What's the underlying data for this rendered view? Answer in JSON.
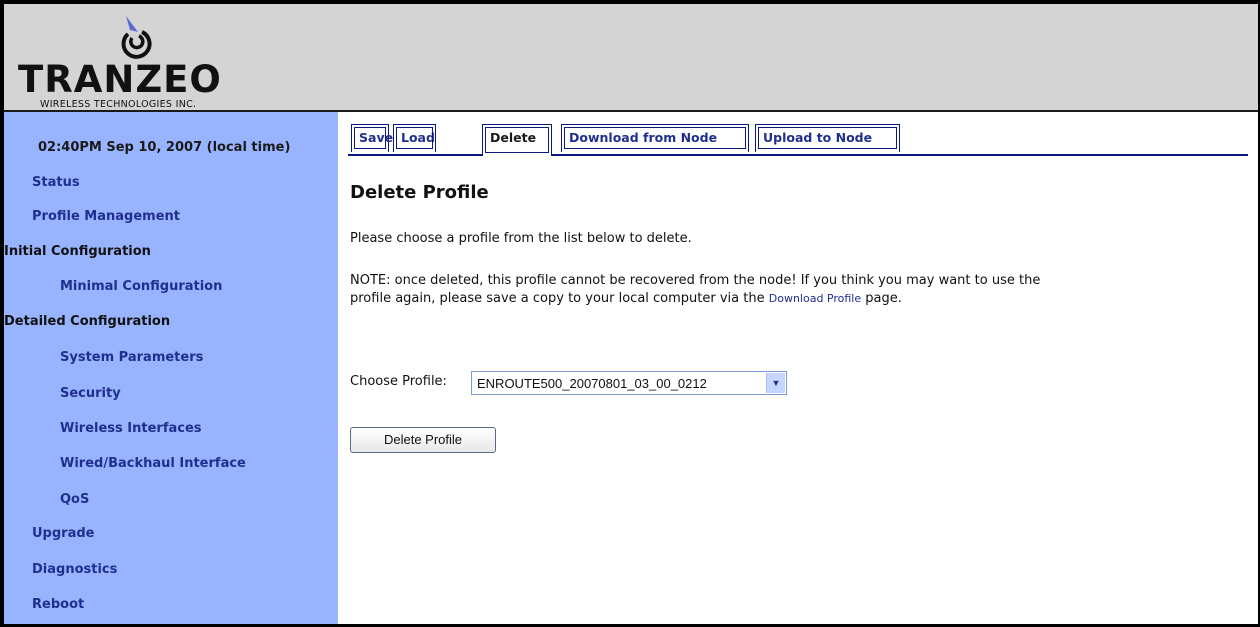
{
  "brand": {
    "logo_text": "TRANZEO",
    "tagline": "WIRELESS TECHNOLOGIES INC."
  },
  "sidebar": {
    "datetime": "02:40PM Sep 10, 2007 (local time)",
    "items": [
      {
        "label": "Status"
      },
      {
        "label": "Profile Management"
      },
      {
        "label": "Initial Configuration"
      },
      {
        "label": "Minimal Configuration"
      },
      {
        "label": "Detailed Configuration"
      },
      {
        "label": "System Parameters"
      },
      {
        "label": "Security"
      },
      {
        "label": "Wireless Interfaces"
      },
      {
        "label": "Wired/Backhaul Interface"
      },
      {
        "label": "QoS"
      },
      {
        "label": "Upgrade"
      },
      {
        "label": "Diagnostics"
      },
      {
        "label": "Reboot"
      }
    ]
  },
  "tabs": [
    {
      "label": "Save"
    },
    {
      "label": "Load"
    },
    {
      "label": "Delete",
      "active": true
    },
    {
      "label": "Download from Node"
    },
    {
      "label": "Upload to Node"
    }
  ],
  "main": {
    "title": "Delete Profile",
    "intro": "Please choose a profile from the list below to delete.",
    "note_part1": "NOTE: once deleted, this profile cannot be recovered from the node! If you think you may want to use the",
    "note_part2": "profile again, please save a copy to your local computer via the",
    "note_link": "Download Profile",
    "note_part3": "page.",
    "choose_label": "Choose Profile:",
    "selected_profile": "ENROUTE500_20070801_03_00_0212",
    "delete_button": "Delete Profile"
  },
  "colors": {
    "sidebar_bg": "#99b4ff",
    "header_bg": "#d4d4d4",
    "link": "#1f2f8f",
    "tab_border": "#0a1a80"
  }
}
